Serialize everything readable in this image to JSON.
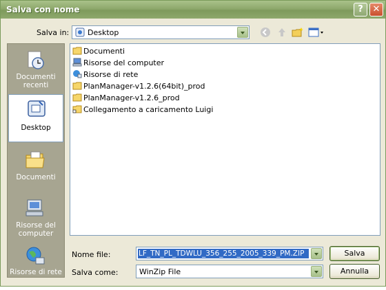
{
  "window": {
    "title": "Salva con nome"
  },
  "toolbar": {
    "save_in_label": "Salva in:",
    "location": "Desktop"
  },
  "places": [
    {
      "label": "Documenti recenti",
      "icon": "recent-documents-icon"
    },
    {
      "label": "Desktop",
      "icon": "desktop-icon"
    },
    {
      "label": "Documenti",
      "icon": "documents-folder-icon"
    },
    {
      "label": "Risorse del computer",
      "icon": "my-computer-icon"
    },
    {
      "label": "Risorse di rete",
      "icon": "network-icon"
    }
  ],
  "files": [
    {
      "name": "Documenti",
      "icon": "documents-folder-icon"
    },
    {
      "name": "Risorse del computer",
      "icon": "my-computer-icon"
    },
    {
      "name": "Risorse di rete",
      "icon": "network-icon"
    },
    {
      "name": "PlanManager-v1.2.6(64bit)_prod",
      "icon": "folder-icon"
    },
    {
      "name": "PlanManager-v1.2.6_prod",
      "icon": "folder-icon"
    },
    {
      "name": "Collegamento a caricamento Luigi",
      "icon": "folder-shortcut-icon"
    }
  ],
  "form": {
    "filename_label": "Nome file:",
    "filename_value": "LF_TN_PL_TDWLU_356_255_2005_339_PM.ZIP",
    "savetype_label": "Salva come:",
    "savetype_value": "WinZip File",
    "save_button": "Salva",
    "cancel_button": "Annulla"
  }
}
